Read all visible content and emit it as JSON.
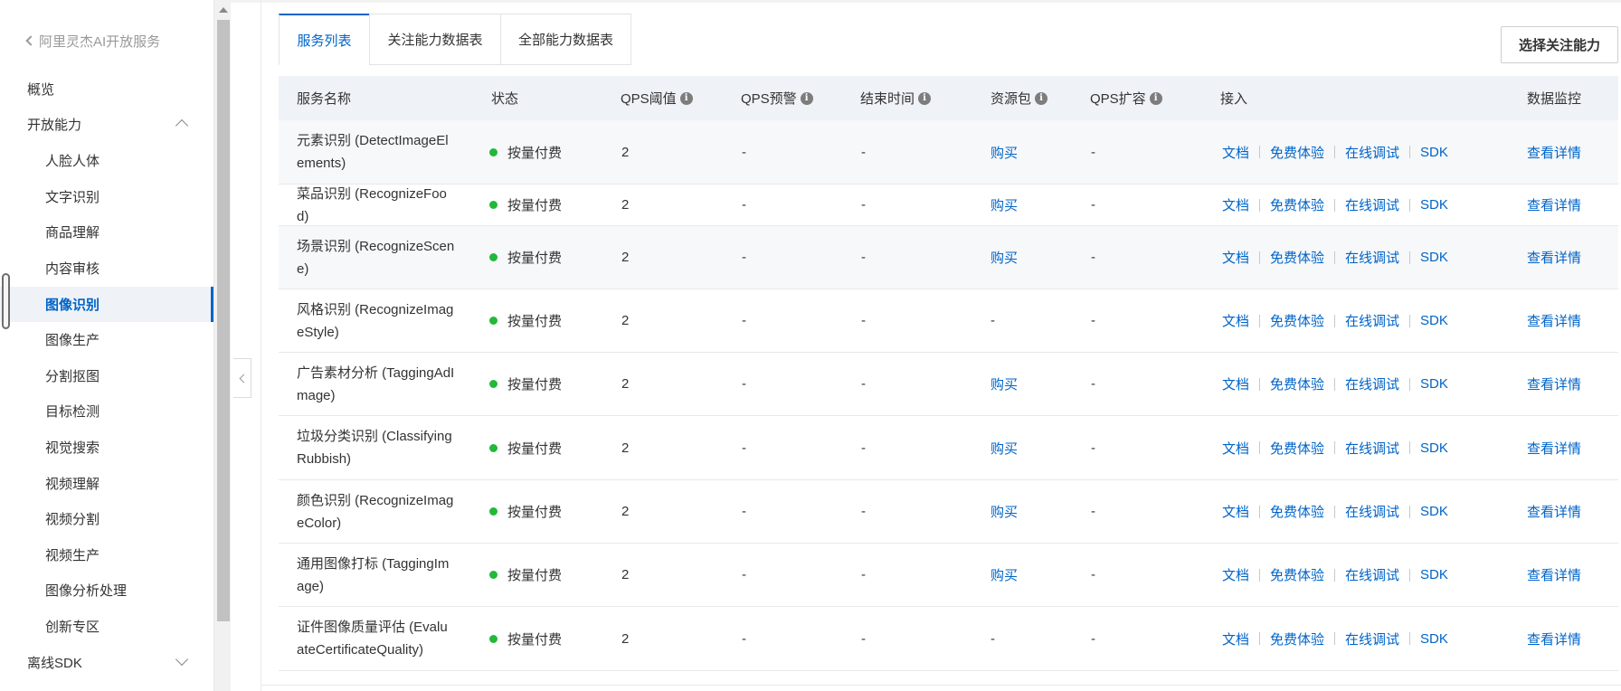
{
  "sidebar": {
    "back_label": "阿里灵杰AI开放服务",
    "items": [
      {
        "label": "概览",
        "level": 1
      },
      {
        "label": "开放能力",
        "level": 1,
        "caret": "up"
      },
      {
        "label": "人脸人体",
        "level": 2
      },
      {
        "label": "文字识别",
        "level": 2
      },
      {
        "label": "商品理解",
        "level": 2
      },
      {
        "label": "内容审核",
        "level": 2
      },
      {
        "label": "图像识别",
        "level": 2,
        "active": true
      },
      {
        "label": "图像生产",
        "level": 2
      },
      {
        "label": "分割抠图",
        "level": 2
      },
      {
        "label": "目标检测",
        "level": 2
      },
      {
        "label": "视觉搜索",
        "level": 2
      },
      {
        "label": "视频理解",
        "level": 2
      },
      {
        "label": "视频分割",
        "level": 2
      },
      {
        "label": "视频生产",
        "level": 2
      },
      {
        "label": "图像分析处理",
        "level": 2
      },
      {
        "label": "创新专区",
        "level": 2
      },
      {
        "label": "离线SDK",
        "level": 1,
        "caret": "down"
      }
    ]
  },
  "tabs": [
    {
      "label": "服务列表",
      "active": true
    },
    {
      "label": "关注能力数据表"
    },
    {
      "label": "全部能力数据表"
    }
  ],
  "focus_button": "选择关注能力",
  "table": {
    "headers": {
      "name": "服务名称",
      "status": "状态",
      "qps_threshold": "QPS阈值",
      "qps_alert": "QPS预警",
      "end_time": "结束时间",
      "resource_pack": "资源包",
      "qps_expand": "QPS扩容",
      "access": "接入",
      "monitor": "数据监控"
    },
    "info_glyph": "i",
    "access_links": {
      "doc": "文档",
      "trial": "免费体验",
      "debug": "在线调试",
      "sdk": "SDK"
    },
    "monitor_link": "查看详情",
    "rows": [
      {
        "name": "元素识别 (DetectImageElements)",
        "status": "按量付费",
        "qps": "2",
        "alert": "-",
        "end": "-",
        "pack": "购买",
        "expand": "-"
      },
      {
        "name": "菜品识别 (RecognizeFood)",
        "status": "按量付费",
        "qps": "2",
        "alert": "-",
        "end": "-",
        "pack": "购买",
        "expand": "-"
      },
      {
        "name": "场景识别 (RecognizeScene)",
        "status": "按量付费",
        "qps": "2",
        "alert": "-",
        "end": "-",
        "pack": "购买",
        "expand": "-"
      },
      {
        "name": "风格识别 (RecognizeImageStyle)",
        "status": "按量付费",
        "qps": "2",
        "alert": "-",
        "end": "-",
        "pack": "-",
        "expand": "-"
      },
      {
        "name": "广告素材分析 (TaggingAdImage)",
        "status": "按量付费",
        "qps": "2",
        "alert": "-",
        "end": "-",
        "pack": "购买",
        "expand": "-"
      },
      {
        "name": "垃圾分类识别 (Classifying Rubbish)",
        "status": "按量付费",
        "qps": "2",
        "alert": "-",
        "end": "-",
        "pack": "购买",
        "expand": "-"
      },
      {
        "name": "颜色识别 (RecognizeImageColor)",
        "status": "按量付费",
        "qps": "2",
        "alert": "-",
        "end": "-",
        "pack": "购买",
        "expand": "-"
      },
      {
        "name": "通用图像打标 (TaggingImage)",
        "status": "按量付费",
        "qps": "2",
        "alert": "-",
        "end": "-",
        "pack": "购买",
        "expand": "-"
      },
      {
        "name": "证件图像质量评估 (EvaluateCertificateQuality)",
        "status": "按量付费",
        "qps": "2",
        "alert": "-",
        "end": "-",
        "pack": "-",
        "expand": "-"
      }
    ]
  },
  "colors": {
    "accent": "#0064c8",
    "status_ok": "#22b83a",
    "brand": "#ff6a00"
  }
}
